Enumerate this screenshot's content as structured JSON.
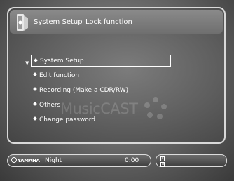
{
  "header": {
    "title": "System Setup",
    "subtitle": "Lock function",
    "icon": "gear-tower-icon"
  },
  "watermark": {
    "text": "MusicCAST"
  },
  "menu": {
    "items": [
      {
        "label": "System Setup",
        "selected": true
      },
      {
        "label": "Edit function",
        "selected": false
      },
      {
        "label": "Recording (Make a CDR/RW)",
        "selected": false
      },
      {
        "label": "Others",
        "selected": false
      },
      {
        "label": "Change password",
        "selected": false
      }
    ]
  },
  "status": {
    "brand": "YAMAHA",
    "source": "Night",
    "time": "0:00",
    "level_left": "L",
    "level_right": "R"
  },
  "colors": {
    "text": "#ffffff",
    "panel": "#5e5e5e"
  }
}
